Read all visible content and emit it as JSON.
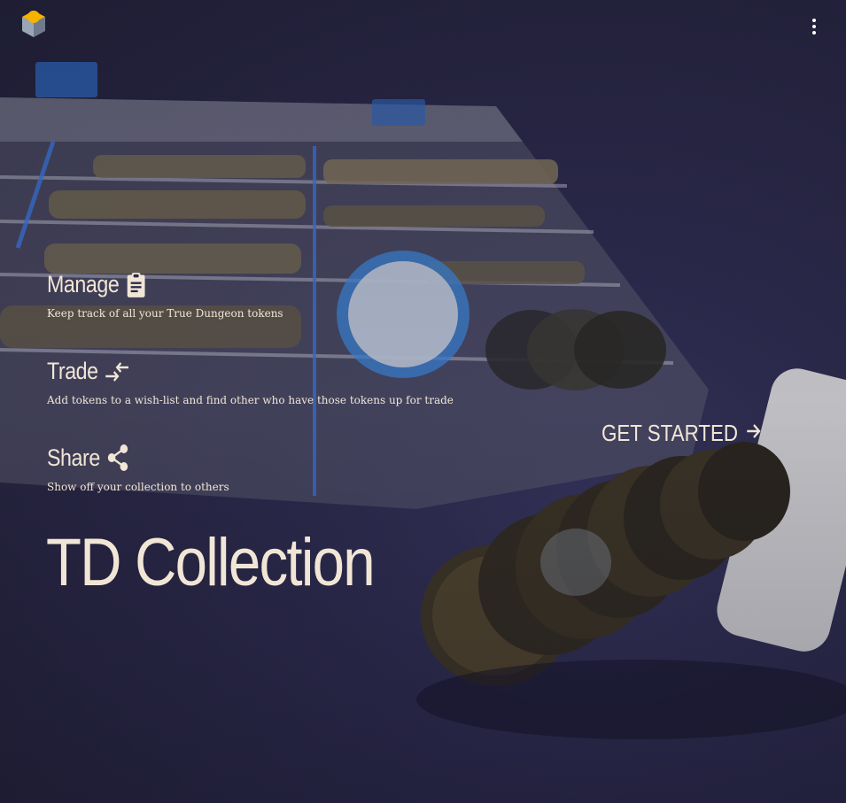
{
  "app": {
    "title": "TD Collection",
    "logo_icon": "cube-logo-icon",
    "menu_icon": "more-vertical-icon"
  },
  "features": [
    {
      "title": "Manage",
      "icon": "clipboard-icon",
      "description": "Keep track of all your True Dungeon tokens"
    },
    {
      "title": "Trade",
      "icon": "swap-arrows-icon",
      "description": "Add tokens to a wish-list and find other who have those tokens up for trade"
    },
    {
      "title": "Share",
      "icon": "share-icon",
      "description": "Show off your collection to others"
    }
  ],
  "cta": {
    "label": "GET STARTED",
    "icon": "arrow-right-icon"
  },
  "colors": {
    "text": "#f1e6d6",
    "background": "#2a2848",
    "logo_yellow": "#f5b300",
    "logo_side": "#8a96a6"
  }
}
